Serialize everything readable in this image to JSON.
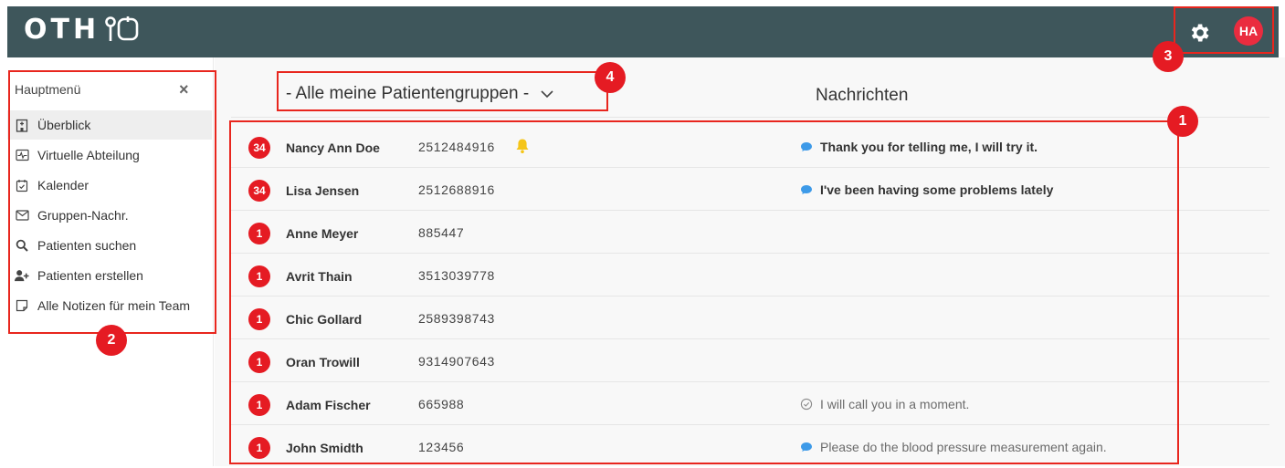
{
  "app": {
    "logo_text": "OTH"
  },
  "header": {
    "avatar_initials": "HA"
  },
  "menu": {
    "title": "Hauptmenü",
    "close_label": "×",
    "items": [
      {
        "label": "Überblick",
        "icon": "hospital-icon"
      },
      {
        "label": "Virtuelle Abteilung",
        "icon": "monitor-pulse-icon"
      },
      {
        "label": "Kalender",
        "icon": "calendar-check-icon"
      },
      {
        "label": "Gruppen-Nachr.",
        "icon": "envelope-icon"
      },
      {
        "label": "Patienten suchen",
        "icon": "search-icon"
      },
      {
        "label": "Patienten erstellen",
        "icon": "user-plus-icon"
      },
      {
        "label": "Alle Notizen für mein Team",
        "icon": "note-icon"
      }
    ]
  },
  "group_select": {
    "label": "- Alle meine Patientengruppen -"
  },
  "messages_header": "Nachrichten",
  "patients": [
    {
      "badge": "34",
      "name": "Nancy Ann Doe",
      "id": "2512484916",
      "bell": true,
      "message": "Thank you for telling me, I will try it.",
      "message_style": "unread"
    },
    {
      "badge": "34",
      "name": "Lisa Jensen",
      "id": "2512688916",
      "bell": false,
      "message": "I've been having some problems lately",
      "message_style": "unread"
    },
    {
      "badge": "1",
      "name": "Anne Meyer",
      "id": "885447",
      "bell": false,
      "message": "",
      "message_style": "none"
    },
    {
      "badge": "1",
      "name": "Avrit Thain",
      "id": "3513039778",
      "bell": false,
      "message": "",
      "message_style": "none"
    },
    {
      "badge": "1",
      "name": "Chic Gollard",
      "id": "2589398743",
      "bell": false,
      "message": "",
      "message_style": "none"
    },
    {
      "badge": "1",
      "name": "Oran Trowill",
      "id": "9314907643",
      "bell": false,
      "message": "",
      "message_style": "none"
    },
    {
      "badge": "1",
      "name": "Adam Fischer",
      "id": "665988",
      "bell": false,
      "message": "I will call you in a moment.",
      "message_style": "read"
    },
    {
      "badge": "1",
      "name": "John Smidth",
      "id": "123456",
      "bell": false,
      "message": "Please do the blood pressure measurement again.",
      "message_style": "sent"
    }
  ],
  "annotations": [
    "1",
    "2",
    "3",
    "4"
  ],
  "colors": {
    "topbar": "#3e565b",
    "accent_red": "#e51b23",
    "chat_blue": "#3d9ae8",
    "bell_yellow": "#f5c518"
  }
}
